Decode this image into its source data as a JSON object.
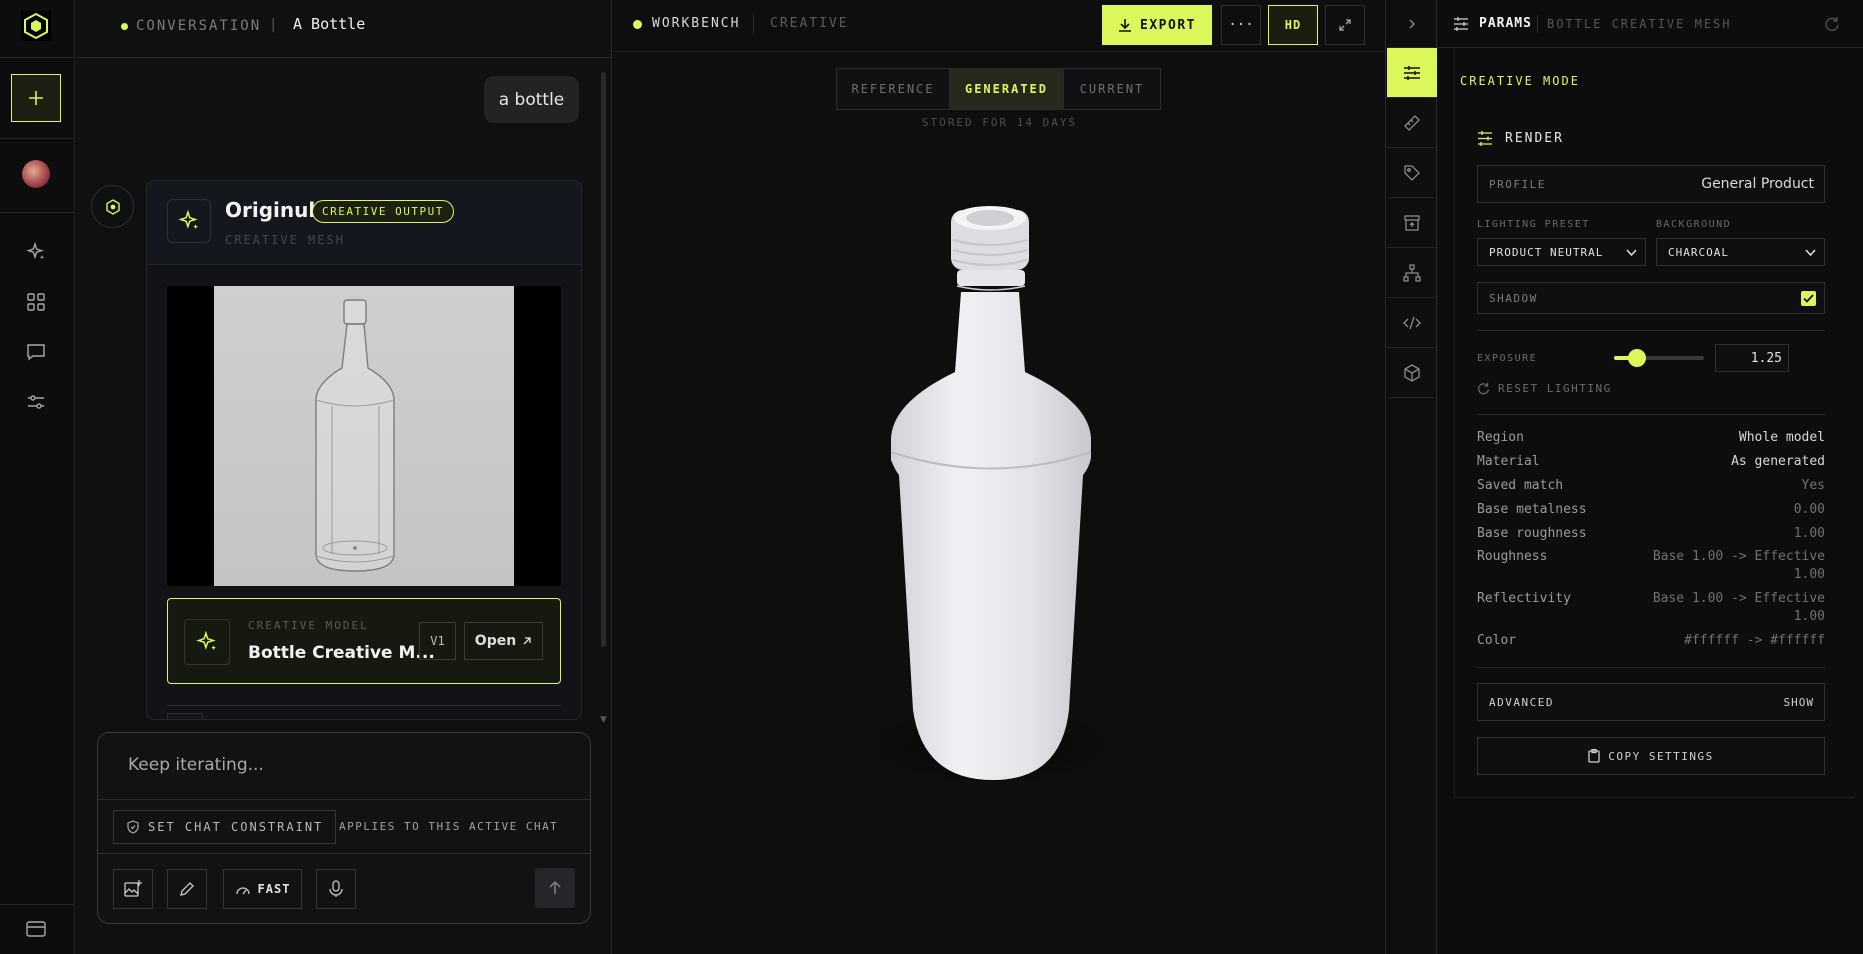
{
  "rail": {
    "icons": [
      "logo-icon",
      "new-plus-icon",
      "avatar",
      "sparkle-icon",
      "grid-icon",
      "chat-icon",
      "sliders-icon",
      "card-icon"
    ]
  },
  "chat": {
    "header_label": "CONVERSATION",
    "title": "A Bottle",
    "user_message": "a bottle",
    "output_title": "Originull",
    "output_badge": "CREATIVE OUTPUT",
    "output_sub": "CREATIVE MESH",
    "model_label": "CREATIVE MODEL",
    "model_name": "Bottle Creative M...",
    "model_version": "V1",
    "open_label": "Open",
    "input_placeholder": "Keep iterating...",
    "constraint_label": "SET CHAT CONSTRAINT",
    "constraint_hint": "APPLIES TO THIS ACTIVE CHAT",
    "speed_label": "FAST"
  },
  "center": {
    "workbench": "WORKBENCH",
    "mode": "CREATIVE",
    "export": "EXPORT",
    "more": "···",
    "hd": "HD",
    "tabs": [
      "REFERENCE",
      "GENERATED",
      "CURRENT"
    ],
    "active_tab": "GENERATED",
    "stored": "STORED FOR 14 DAYS"
  },
  "params": {
    "title": "PARAMS",
    "subtitle": "BOTTLE CREATIVE MESH",
    "mode": "CREATIVE MODE",
    "section": "RENDER",
    "profile_label": "PROFILE",
    "profile_value": "General Product",
    "lighting_label": "LIGHTING PRESET",
    "lighting_value": "PRODUCT NEUTRAL",
    "background_label": "BACKGROUND",
    "background_value": "CHARCOAL",
    "shadow_label": "SHADOW",
    "shadow_checked": true,
    "exposure_label": "EXPOSURE",
    "exposure_value": "1.25",
    "exposure_fraction": 0.25,
    "reset": "RESET LIGHTING",
    "rows": [
      {
        "k": "Region",
        "v": "Whole model",
        "dim": false
      },
      {
        "k": "Material",
        "v": "As generated",
        "dim": false
      },
      {
        "k": "Saved match",
        "v": "Yes",
        "dim": true
      },
      {
        "k": "Base metalness",
        "v": "0.00",
        "dim": true
      },
      {
        "k": "Base roughness",
        "v": "1.00",
        "dim": true
      }
    ],
    "roughness_k": "Roughness",
    "roughness_v1": "Base 1.00 -> Effective",
    "roughness_v2": "1.00",
    "reflect_k": "Reflectivity",
    "reflect_v1": "Base 1.00 -> Effective",
    "reflect_v2": "1.00",
    "color_k": "Color",
    "color_v": "#ffffff -> #ffffff",
    "advanced": "ADVANCED",
    "show": "SHOW",
    "copy": "COPY SETTINGS"
  },
  "colors": {
    "accent": "#dcf75a",
    "bg": "#0b0b0c"
  }
}
